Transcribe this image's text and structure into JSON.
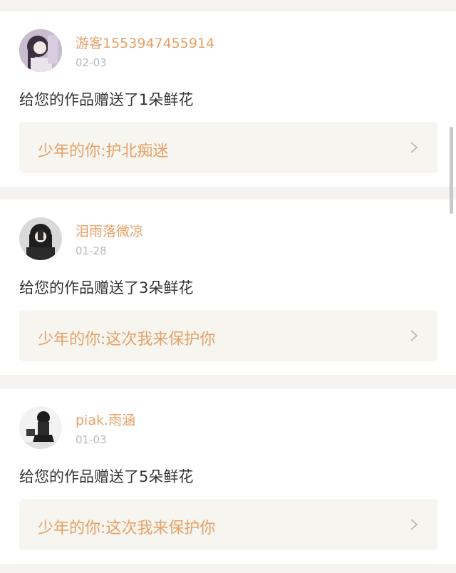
{
  "notifications": [
    {
      "username": "游客1553947455914",
      "date": "02-03",
      "message": "给您的作品赠送了1朵鲜花",
      "work_title": "少年的你:护北痴迷",
      "avatar": "avatar-icon"
    },
    {
      "username": "泪雨落微凉",
      "date": "01-28",
      "message": "给您的作品赠送了3朵鲜花",
      "work_title": "少年的你:这次我来保护你",
      "avatar": "avatar-icon"
    },
    {
      "username": "piak.雨涵",
      "date": "01-03",
      "message": "给您的作品赠送了5朵鲜花",
      "work_title": "少年的你:这次我来保护你",
      "avatar": "avatar-icon"
    }
  ],
  "colors": {
    "accent": "#e8a067",
    "text": "#333333",
    "muted": "#b9b9b9",
    "link_bg": "#f6f5ef",
    "page_bg": "#f5f3f1"
  },
  "icons": {
    "chevron": "chevron-right-icon"
  }
}
